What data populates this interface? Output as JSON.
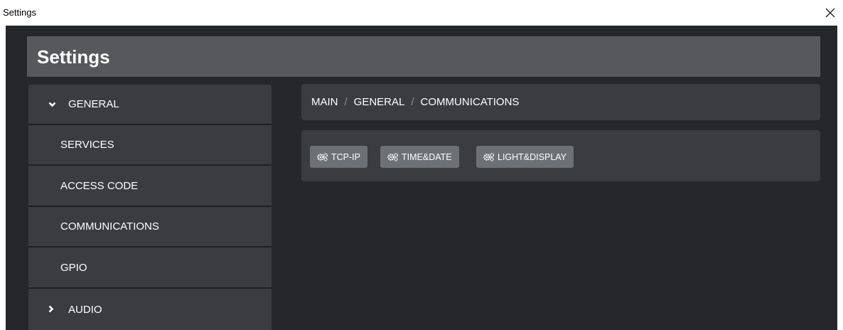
{
  "window": {
    "title": "Settings",
    "close_glyph": "✕"
  },
  "header": {
    "title": "Settings"
  },
  "sidebar": {
    "items": [
      {
        "label": "GENERAL",
        "chevron": "down",
        "level": "top"
      },
      {
        "label": "SERVICES",
        "level": "sub"
      },
      {
        "label": "ACCESS CODE",
        "level": "sub"
      },
      {
        "label": "COMMUNICATIONS",
        "level": "sub"
      },
      {
        "label": "GPIO",
        "level": "sub"
      },
      {
        "label": "AUDIO",
        "chevron": "right",
        "level": "top"
      }
    ]
  },
  "breadcrumb": {
    "items": [
      "MAIN",
      "GENERAL",
      "COMMUNICATIONS"
    ],
    "separator": "/"
  },
  "buttons": [
    {
      "label": "TCP-IP",
      "icon": "cogs-icon"
    },
    {
      "label": "TIME&DATE",
      "icon": "cogs-icon"
    },
    {
      "label": "LIGHT&DISPLAY",
      "icon": "cogs-icon"
    }
  ],
  "colors": {
    "background": "#25272b",
    "header": "#56585c",
    "panel": "#3a3c40",
    "button": "#6d7074",
    "text": "#ffffff"
  }
}
